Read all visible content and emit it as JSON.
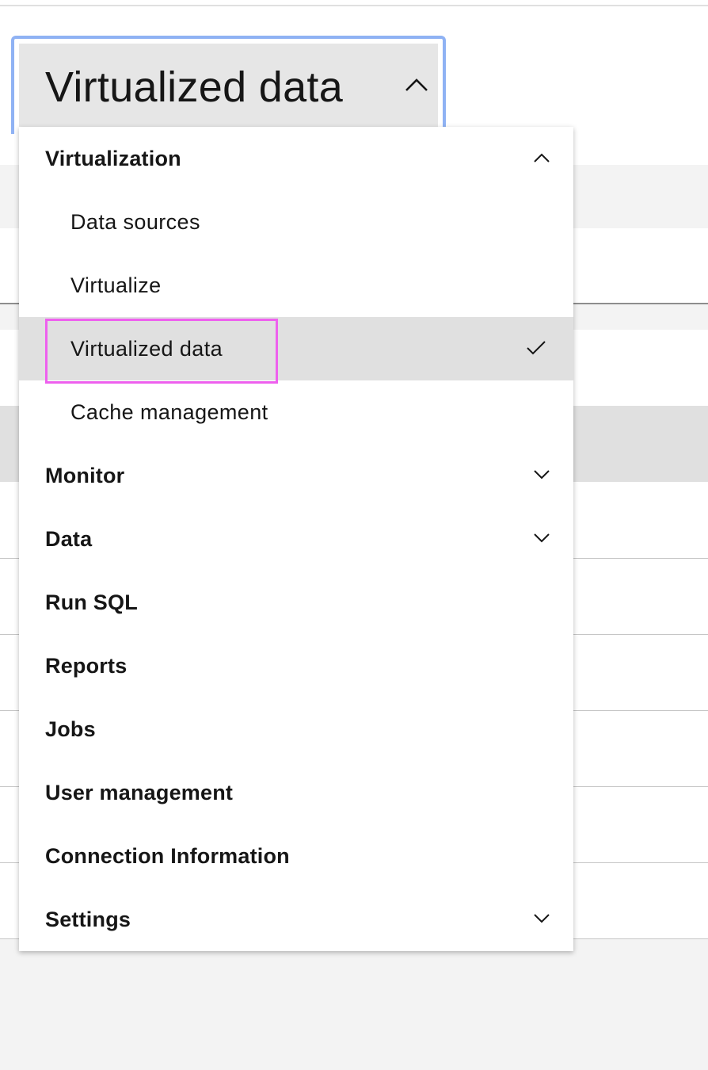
{
  "dropdown": {
    "selected_label": "Virtualized data",
    "chevron_icon": "chevron-up-icon"
  },
  "menu": {
    "items": [
      {
        "label": "Virtualization",
        "kind": "category",
        "expanded": true,
        "icon": "chevron-up-icon"
      },
      {
        "label": "Data sources",
        "kind": "sub"
      },
      {
        "label": "Virtualize",
        "kind": "sub"
      },
      {
        "label": "Virtualized data",
        "kind": "sub",
        "selected": true,
        "icon": "checkmark-icon"
      },
      {
        "label": "Cache management",
        "kind": "sub"
      },
      {
        "label": "Monitor",
        "kind": "category",
        "expanded": false,
        "icon": "chevron-down-icon"
      },
      {
        "label": "Data",
        "kind": "category",
        "expanded": false,
        "icon": "chevron-down-icon"
      },
      {
        "label": "Run SQL",
        "kind": "category"
      },
      {
        "label": "Reports",
        "kind": "category"
      },
      {
        "label": "Jobs",
        "kind": "category"
      },
      {
        "label": "User management",
        "kind": "category"
      },
      {
        "label": "Connection Information",
        "kind": "category"
      },
      {
        "label": "Settings",
        "kind": "category",
        "expanded": false,
        "icon": "chevron-down-icon"
      }
    ]
  },
  "colors": {
    "focus_ring": "#8fb2f4",
    "selected_bg": "#e0e0e0",
    "highlight_annotation": "#ee60ee",
    "text": "#161616"
  }
}
